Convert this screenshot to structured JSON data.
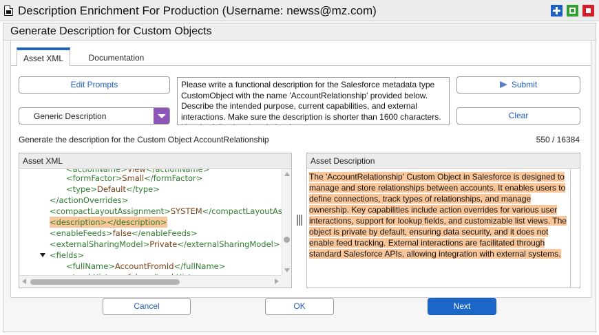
{
  "window": {
    "title": "Description Enrichment For Production (Username: newss@mz.com)"
  },
  "dialog": {
    "title": "Generate Description for Custom Objects"
  },
  "tabs": [
    {
      "label": "Asset XML",
      "active": true
    },
    {
      "label": "Documentation",
      "active": false
    }
  ],
  "controls": {
    "edit_prompts_label": "Edit Prompts",
    "dropdown_value": "Generic Description",
    "submit_label": "Submit",
    "clear_label": "Clear"
  },
  "prompt": {
    "text": "Please write a functional description for the Salesforce metadata type CustomObject with the name 'AccountRelationship' provided below. Describe the intended purpose, current capabilities, and external interactions. Make sure the description is shorter than 1600 characters. Use the following description format:"
  },
  "caption": "Generate the description for the Custom Object AccountRelationship",
  "counter": "550 / 16384",
  "xml_panel": {
    "header": "Asset XML",
    "lines": [
      {
        "open": "<actionName>",
        "value": "View",
        "close": "</actionName>",
        "indent": 2
      },
      {
        "open": "<formFactor>",
        "value": "Small",
        "close": "</formFactor>",
        "indent": 2
      },
      {
        "open": "<type>",
        "value": "Default",
        "close": "</type>",
        "indent": 2
      },
      {
        "open": "</actionOverrides>",
        "value": "",
        "close": "",
        "indent": 1
      },
      {
        "open": "<compactLayoutAssignment>",
        "value": "SYSTEM",
        "close": "</compactLayoutAssignment>",
        "indent": 1
      },
      {
        "open": "<description>",
        "value": "",
        "close": "</description>",
        "indent": 1
      },
      {
        "open": "<enableFeeds>",
        "value": "false",
        "close": "</enableFeeds>",
        "indent": 1
      },
      {
        "open": "<externalSharingModel>",
        "value": "Private",
        "close": "</externalSharingModel>",
        "indent": 1
      },
      {
        "open": "<fields>",
        "value": "",
        "close": "",
        "indent": 1
      },
      {
        "open": "<fullName>",
        "value": "AccountFromId",
        "close": "</fullName>",
        "indent": 2
      },
      {
        "open": "<trackHistory>",
        "value": "false",
        "close": "</trackHistory>",
        "indent": 2
      }
    ]
  },
  "description_panel": {
    "header": "Asset Description",
    "text": "The 'AccountRelationship' Custom Object in Salesforce is designed to manage and store relationships between accounts. It enables users to define connections, track types of relationships, and manage ownership. Key capabilities include action overrides for various user interactions, support for lookup fields, and customizable list views. The object is private by default, ensuring data security, and it does not enable feed tracking. External interactions are facilitated through standard Salesforce APIs, allowing integration with external systems."
  },
  "footer": {
    "cancel_label": "Cancel",
    "ok_label": "OK",
    "next_label": "Next"
  },
  "colors": {
    "accent": "#1c66c7",
    "dropdown_arrow": "#8e55b8",
    "highlight": "#f9c69a",
    "xml_tag": "#2f7d2f",
    "xml_value": "#7a3f16"
  }
}
